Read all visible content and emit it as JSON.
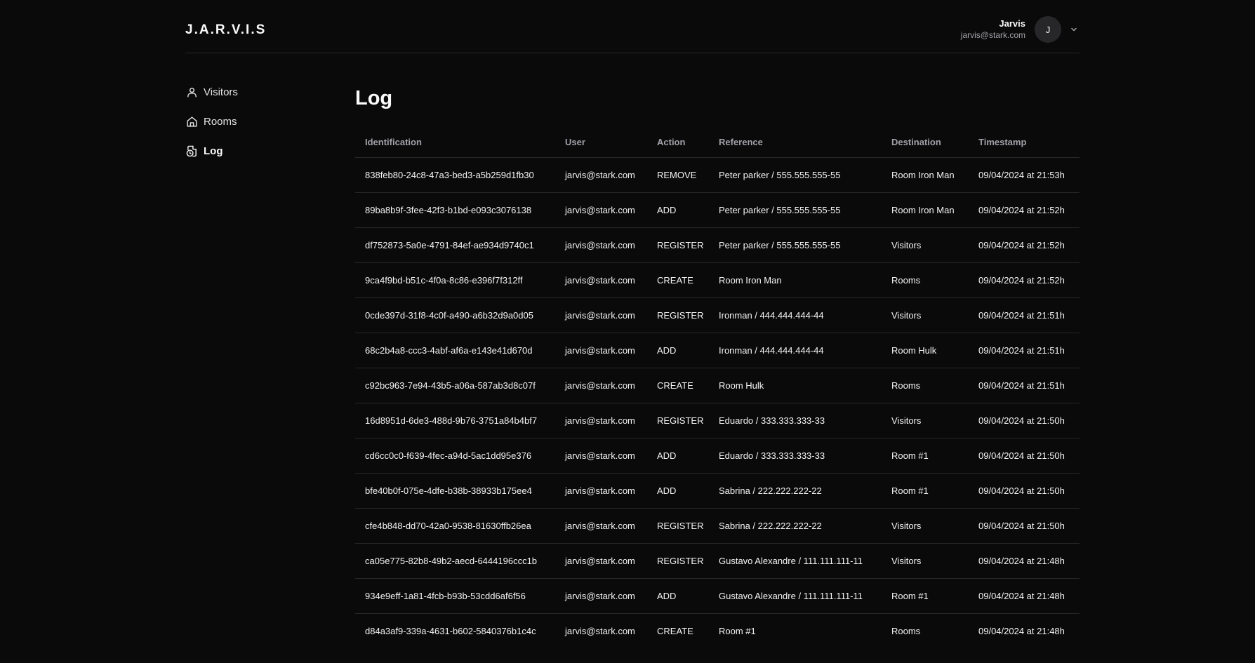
{
  "app": {
    "logo": "J.A.R.V.I.S"
  },
  "user": {
    "name": "Jarvis",
    "email": "jarvis@stark.com",
    "initial": "J"
  },
  "sidebar": {
    "items": [
      {
        "label": "Visitors",
        "icon": "user-icon"
      },
      {
        "label": "Rooms",
        "icon": "home-icon"
      },
      {
        "label": "Log",
        "icon": "log-icon",
        "active": true
      }
    ]
  },
  "main": {
    "title": "Log",
    "table": {
      "headers": [
        "Identification",
        "User",
        "Action",
        "Reference",
        "Destination",
        "Timestamp"
      ],
      "rows": [
        [
          "838feb80-24c8-47a3-bed3-a5b259d1fb30",
          "jarvis@stark.com",
          "REMOVE",
          "Peter parker / 555.555.555-55",
          "Room Iron Man",
          "09/04/2024 at 21:53h"
        ],
        [
          "89ba8b9f-3fee-42f3-b1bd-e093c3076138",
          "jarvis@stark.com",
          "ADD",
          "Peter parker / 555.555.555-55",
          "Room Iron Man",
          "09/04/2024 at 21:52h"
        ],
        [
          "df752873-5a0e-4791-84ef-ae934d9740c1",
          "jarvis@stark.com",
          "REGISTER",
          "Peter parker / 555.555.555-55",
          "Visitors",
          "09/04/2024 at 21:52h"
        ],
        [
          "9ca4f9bd-b51c-4f0a-8c86-e396f7f312ff",
          "jarvis@stark.com",
          "CREATE",
          "Room Iron Man",
          "Rooms",
          "09/04/2024 at 21:52h"
        ],
        [
          "0cde397d-31f8-4c0f-a490-a6b32d9a0d05",
          "jarvis@stark.com",
          "REGISTER",
          "Ironman / 444.444.444-44",
          "Visitors",
          "09/04/2024 at 21:51h"
        ],
        [
          "68c2b4a8-ccc3-4abf-af6a-e143e41d670d",
          "jarvis@stark.com",
          "ADD",
          "Ironman / 444.444.444-44",
          "Room Hulk",
          "09/04/2024 at 21:51h"
        ],
        [
          "c92bc963-7e94-43b5-a06a-587ab3d8c07f",
          "jarvis@stark.com",
          "CREATE",
          "Room Hulk",
          "Rooms",
          "09/04/2024 at 21:51h"
        ],
        [
          "16d8951d-6de3-488d-9b76-3751a84b4bf7",
          "jarvis@stark.com",
          "REGISTER",
          "Eduardo / 333.333.333-33",
          "Visitors",
          "09/04/2024 at 21:50h"
        ],
        [
          "cd6cc0c0-f639-4fec-a94d-5ac1dd95e376",
          "jarvis@stark.com",
          "ADD",
          "Eduardo / 333.333.333-33",
          "Room #1",
          "09/04/2024 at 21:50h"
        ],
        [
          "bfe40b0f-075e-4dfe-b38b-38933b175ee4",
          "jarvis@stark.com",
          "ADD",
          "Sabrina / 222.222.222-22",
          "Room #1",
          "09/04/2024 at 21:50h"
        ],
        [
          "cfe4b848-dd70-42a0-9538-81630ffb26ea",
          "jarvis@stark.com",
          "REGISTER",
          "Sabrina / 222.222.222-22",
          "Visitors",
          "09/04/2024 at 21:50h"
        ],
        [
          "ca05e775-82b8-49b2-aecd-6444196ccc1b",
          "jarvis@stark.com",
          "REGISTER",
          "Gustavo Alexandre / 111.111.111-11",
          "Visitors",
          "09/04/2024 at 21:48h"
        ],
        [
          "934e9eff-1a81-4fcb-b93b-53cdd6af6f56",
          "jarvis@stark.com",
          "ADD",
          "Gustavo Alexandre / 111.111.111-11",
          "Room #1",
          "09/04/2024 at 21:48h"
        ],
        [
          "d84a3af9-339a-4631-b602-5840376b1c4c",
          "jarvis@stark.com",
          "CREATE",
          "Room #1",
          "Rooms",
          "09/04/2024 at 21:48h"
        ]
      ]
    }
  }
}
